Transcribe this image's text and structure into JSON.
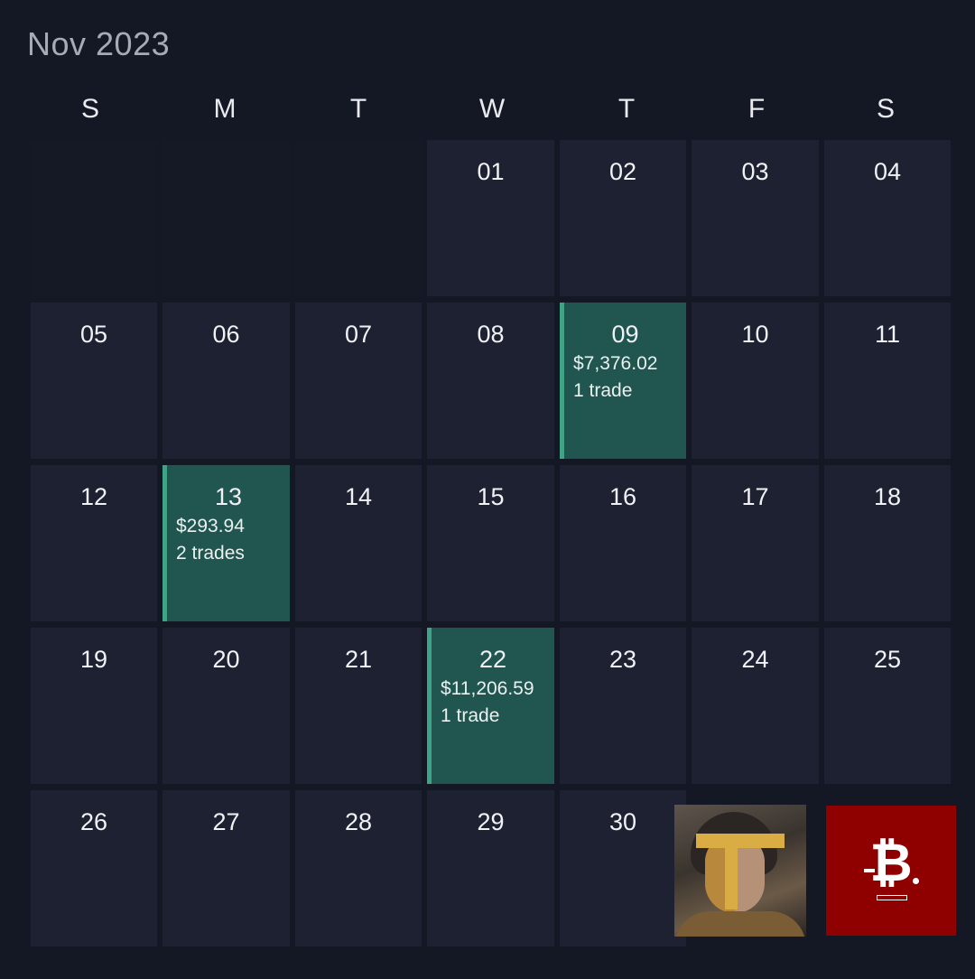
{
  "calendar": {
    "month_label": "Nov 2023",
    "weekdays": [
      "S",
      "M",
      "T",
      "W",
      "T",
      "F",
      "S"
    ],
    "weeks": [
      [
        {
          "day": ""
        },
        {
          "day": ""
        },
        {
          "day": ""
        },
        {
          "day": "01"
        },
        {
          "day": "02"
        },
        {
          "day": "03"
        },
        {
          "day": "04"
        }
      ],
      [
        {
          "day": "05"
        },
        {
          "day": "06"
        },
        {
          "day": "07"
        },
        {
          "day": "08"
        },
        {
          "day": "09",
          "pnl": "$7,376.02",
          "trades": "1 trade"
        },
        {
          "day": "10"
        },
        {
          "day": "11"
        }
      ],
      [
        {
          "day": "12"
        },
        {
          "day": "13",
          "pnl": "$293.94",
          "trades": "2 trades"
        },
        {
          "day": "14"
        },
        {
          "day": "15"
        },
        {
          "day": "16"
        },
        {
          "day": "17"
        },
        {
          "day": "18"
        }
      ],
      [
        {
          "day": "19"
        },
        {
          "day": "20"
        },
        {
          "day": "21"
        },
        {
          "day": "22",
          "pnl": "$11,206.59",
          "trades": "1 trade"
        },
        {
          "day": "23"
        },
        {
          "day": "24"
        },
        {
          "day": "25"
        }
      ],
      [
        {
          "day": "26"
        },
        {
          "day": "27"
        },
        {
          "day": "28"
        },
        {
          "day": "29"
        },
        {
          "day": "30"
        }
      ]
    ]
  },
  "overlays": {
    "portrait_icon": "portrait-thumbnail",
    "brand_icon": "bitcoin-logo-thumbnail",
    "brand_text": "-B."
  },
  "colors": {
    "background": "#141824",
    "cell": "#1d2131",
    "trade_cell": "#215550",
    "trade_accent": "#3fa386",
    "brand_red": "#8f0000"
  }
}
